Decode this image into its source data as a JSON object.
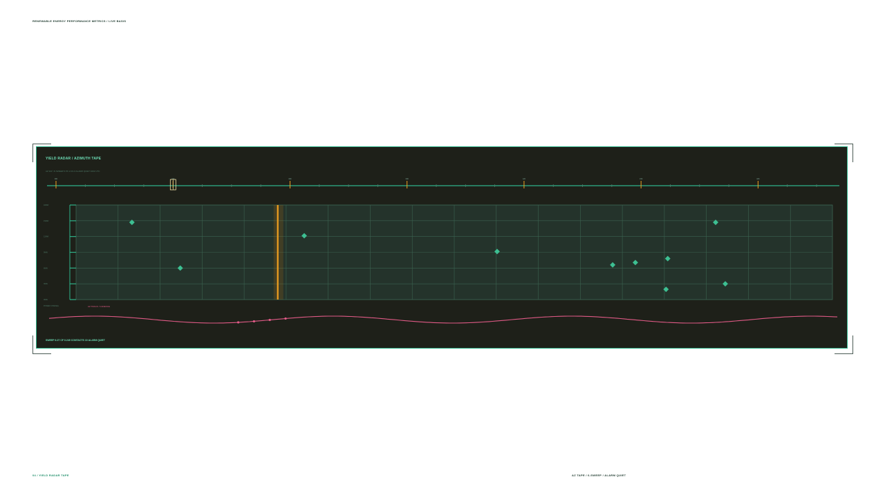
{
  "page": {
    "title": "RENEWABLE ENERGY PERFORMANCE METRICS / LIVE BASIS",
    "footer_left": "04 / YIELD RADAR TAPE",
    "footer_right": "AZ TAPE / 6-SWEEP / ALARM QUIET"
  },
  "panel": {
    "title": "YIELD RADAR  /  AZIMUTH TAPE",
    "subtitle": "AZ 321°-N  SWEEP 6  PK 2.2/1.0   ALARM QUIET   0432 UTC",
    "footer": "SWEEP 6.27   CF 0.249   CONTACTS 10   ALARM QUIET",
    "grid_legend_left": "POWER CHANNEL",
    "grid_legend_right": "AZ TRACK / CADENCE"
  },
  "colors": {
    "panel_bg": "#1e2019",
    "accent": "#2fb38a",
    "contact": "#3dbf92",
    "sweep": "#f0a020",
    "trace": "#e05a86"
  },
  "tape": {
    "major_labels": [
      "000",
      "030",
      "060",
      "090",
      "120",
      "150",
      "180"
    ],
    "selected_tick": 1
  },
  "chart_data": {
    "type": "scatter",
    "x_range": [
      0,
      18
    ],
    "y_range": [
      0,
      6
    ],
    "y_ticks": [
      "18MW",
      "15MW",
      "12MW",
      "9MW",
      "6MW",
      "3MW",
      "0MW"
    ],
    "sweep_position": 4.8,
    "points": [
      {
        "x": 1.33,
        "y": 4.9
      },
      {
        "x": 2.48,
        "y": 2.0
      },
      {
        "x": 5.43,
        "y": 4.05
      },
      {
        "x": 10.02,
        "y": 3.05
      },
      {
        "x": 12.77,
        "y": 2.2
      },
      {
        "x": 13.31,
        "y": 2.35
      },
      {
        "x": 14.08,
        "y": 2.6
      },
      {
        "x": 14.04,
        "y": 0.65
      },
      {
        "x": 15.22,
        "y": 4.9
      },
      {
        "x": 15.45,
        "y": 1.0
      }
    ],
    "trace_markers": [
      0.24,
      0.26,
      0.28,
      0.3
    ]
  }
}
